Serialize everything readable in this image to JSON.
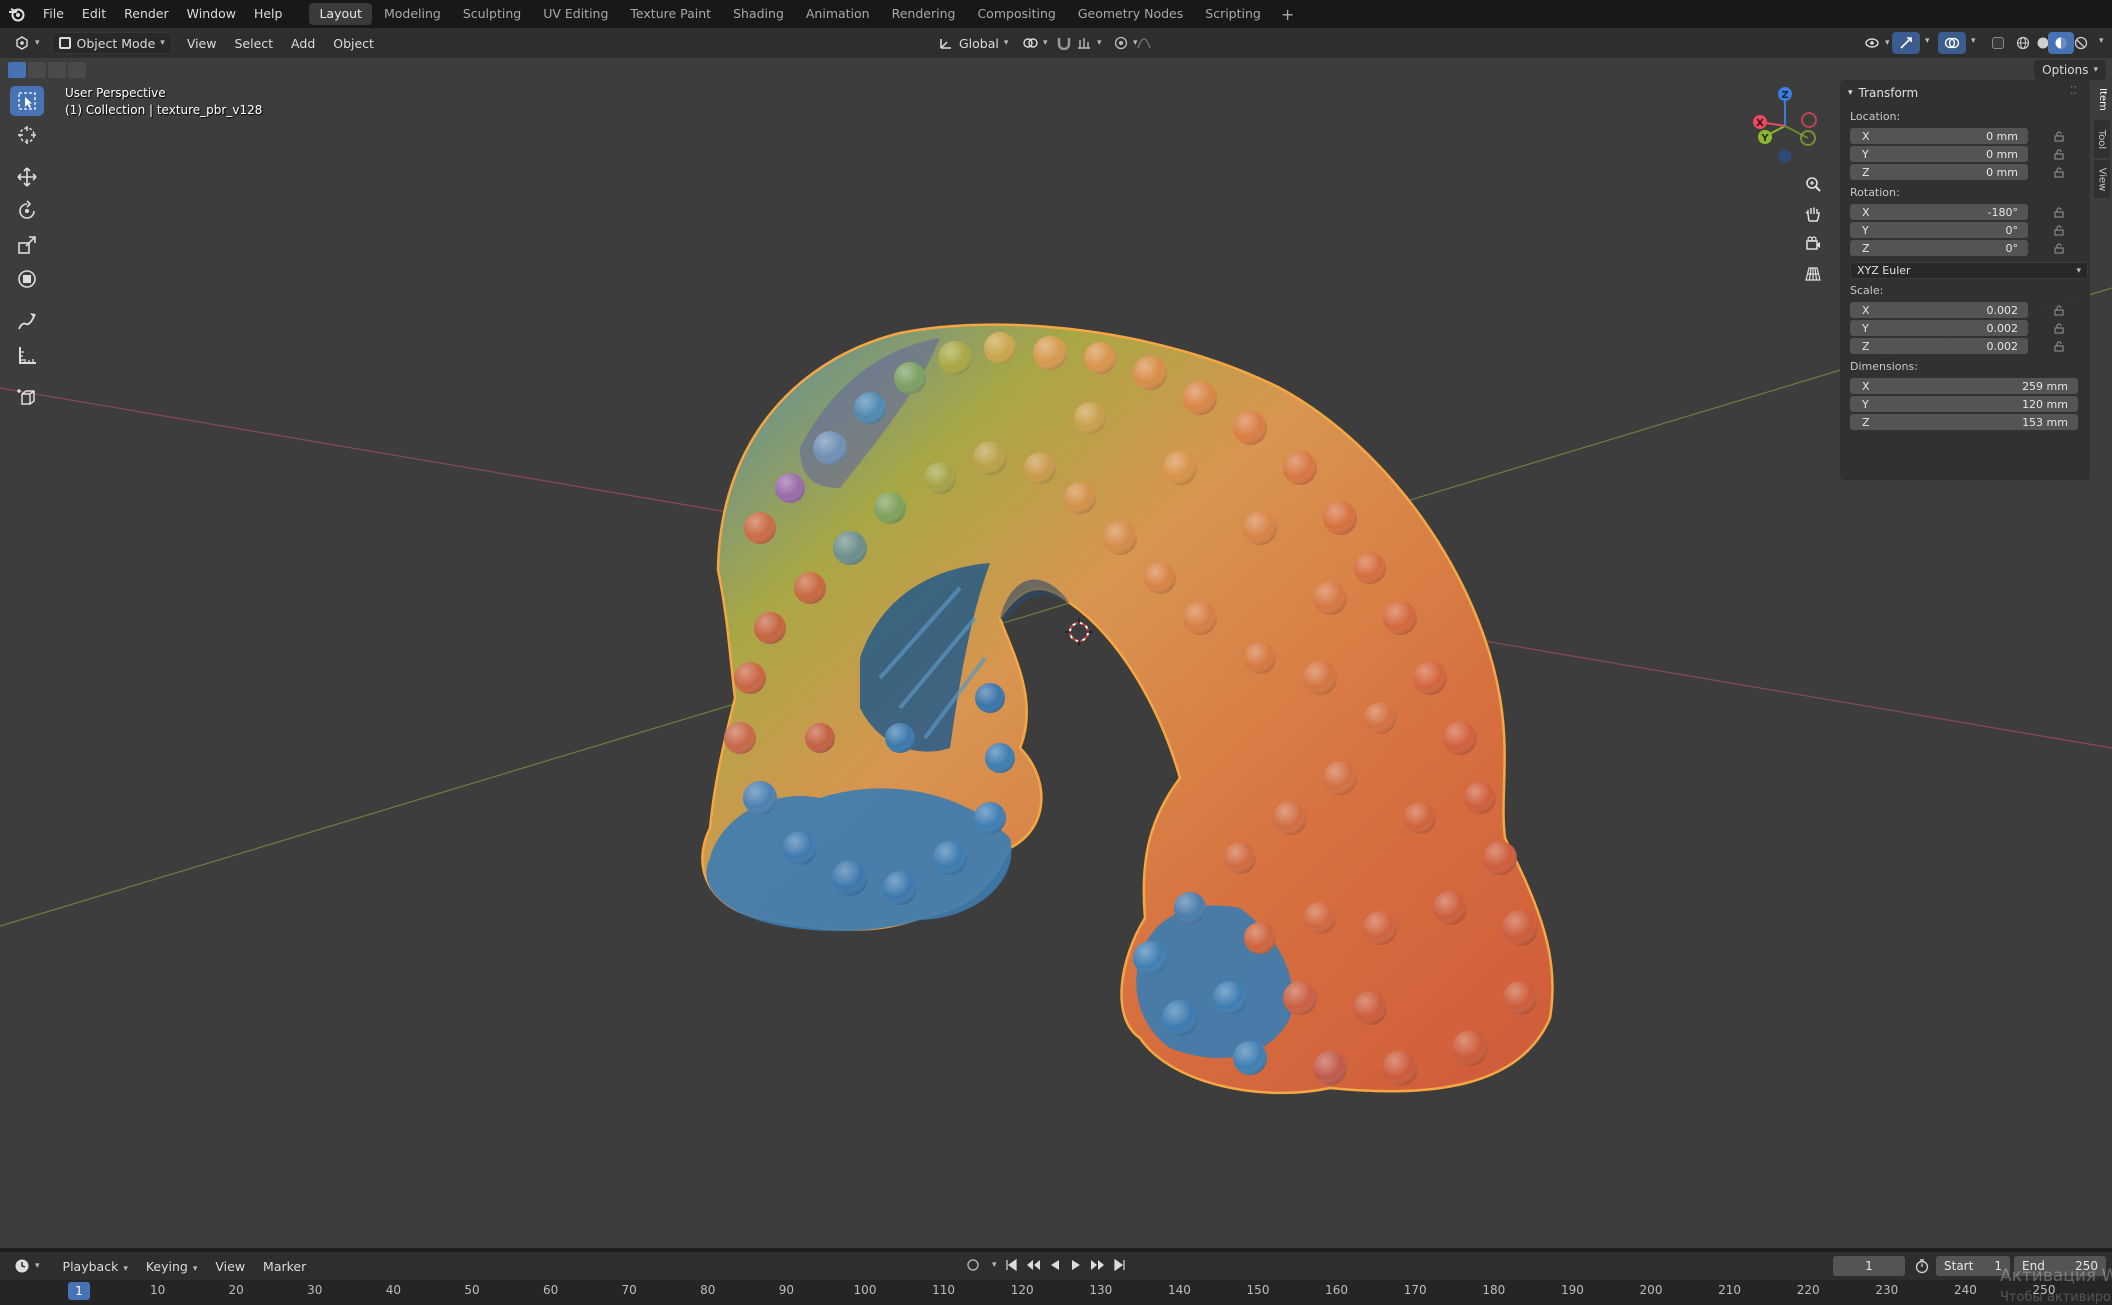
{
  "topbar": {
    "menus": [
      "File",
      "Edit",
      "Render",
      "Window",
      "Help"
    ],
    "workspaces": [
      "Layout",
      "Modeling",
      "Sculpting",
      "UV Editing",
      "Texture Paint",
      "Shading",
      "Animation",
      "Rendering",
      "Compositing",
      "Geometry Nodes",
      "Scripting"
    ],
    "active_workspace": "Layout",
    "add_tab": "+"
  },
  "viewport_header": {
    "mode": "Object Mode",
    "menus": [
      "View",
      "Select",
      "Add",
      "Object"
    ],
    "transform_orientation": "Global"
  },
  "viewport": {
    "options_label": "Options",
    "perspective_text": "User Perspective",
    "collection_text": "(1) Collection | texture_pbr_v128",
    "gizmo_axes": {
      "x": "X",
      "y": "Y",
      "z": "Z"
    },
    "colors": {
      "x_axis": "#e84a5f",
      "y_axis": "#8bb82f",
      "z_axis": "#3b7fde",
      "selection_outline": "#f5a742",
      "active_tool": "#4772b3"
    }
  },
  "npanel": {
    "title": "Transform",
    "location_label": "Location:",
    "location": [
      {
        "axis": "X",
        "value": "0 mm"
      },
      {
        "axis": "Y",
        "value": "0 mm"
      },
      {
        "axis": "Z",
        "value": "0 mm"
      }
    ],
    "rotation_label": "Rotation:",
    "rotation": [
      {
        "axis": "X",
        "value": "-180°"
      },
      {
        "axis": "Y",
        "value": "0°"
      },
      {
        "axis": "Z",
        "value": "0°"
      }
    ],
    "rotation_mode": "XYZ Euler",
    "scale_label": "Scale:",
    "scale": [
      {
        "axis": "X",
        "value": "0.002"
      },
      {
        "axis": "Y",
        "value": "0.002"
      },
      {
        "axis": "Z",
        "value": "0.002"
      }
    ],
    "dimensions_label": "Dimensions:",
    "dimensions": [
      {
        "axis": "X",
        "value": "259 mm"
      },
      {
        "axis": "Y",
        "value": "120 mm"
      },
      {
        "axis": "Z",
        "value": "153 mm"
      }
    ],
    "tabs": [
      "Item",
      "Tool",
      "View"
    ]
  },
  "timeline": {
    "menus": [
      "Playback",
      "Keying",
      "View",
      "Marker"
    ],
    "current_frame": "1",
    "start_label": "Start",
    "start_value": "1",
    "end_label": "End",
    "end_value": "250",
    "ruler": [
      "1",
      "10",
      "20",
      "30",
      "40",
      "50",
      "60",
      "70",
      "80",
      "90",
      "100",
      "110",
      "120",
      "130",
      "140",
      "150",
      "160",
      "170",
      "180",
      "190",
      "200",
      "210",
      "220",
      "230",
      "240",
      "250"
    ]
  },
  "watermark": {
    "line1": "Активация W",
    "line2": "Чтобы активиро"
  }
}
